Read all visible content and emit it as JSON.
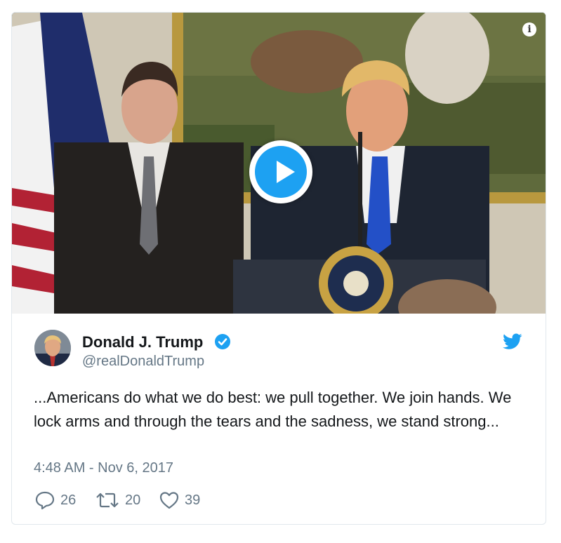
{
  "tweet": {
    "author_name": "Donald J. Trump",
    "author_handle": "@realDonaldTrump",
    "text": "...Americans do what we do best: we pull together. We join hands. We lock arms and through the tears and the sadness, we stand strong...",
    "timestamp": "4:48 AM - Nov 6, 2017",
    "verified": true
  },
  "actions": {
    "reply_count": "26",
    "retweet_count": "20",
    "like_count": "39"
  },
  "media": {
    "type": "video",
    "play_icon": "play-icon",
    "info_icon": "info-icon"
  },
  "colors": {
    "accent": "#1da1f2",
    "text_primary": "#14171a",
    "text_secondary": "#657786",
    "border": "#e1e8ed"
  }
}
